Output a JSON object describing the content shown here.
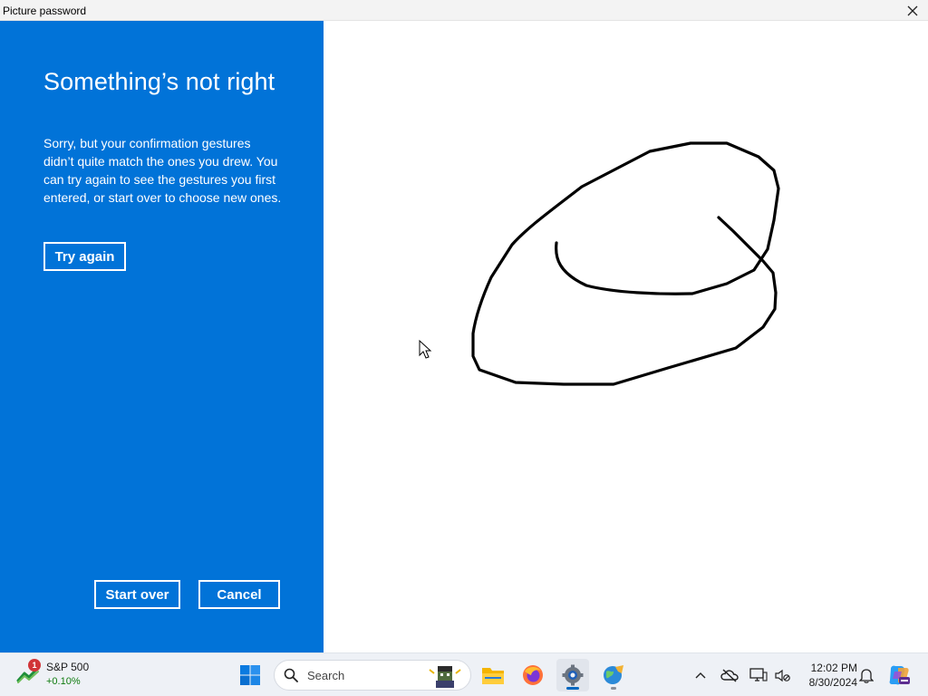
{
  "window": {
    "title": "Picture password"
  },
  "panel": {
    "heading": "Something’s not right",
    "message": "Sorry, but your confirmation gestures didn’t quite match the ones you drew. You can try again to see the gestures you first entered, or start over to choose new ones.",
    "try_again_label": "Try again",
    "start_over_label": "Start over",
    "cancel_label": "Cancel"
  },
  "colors": {
    "panel_bg": "#0173d8",
    "stroke": "#000000",
    "taskbar_bg": "#eef1f6"
  },
  "taskbar": {
    "widget": {
      "name": "S&P 500",
      "change": "+0.10%",
      "badge": "1"
    },
    "search_placeholder": "Search",
    "apps": [
      "start-icon",
      "file-explorer-icon",
      "firefox-icon",
      "settings-icon",
      "globe-app-icon"
    ],
    "tray_icons": [
      "chevron-up-icon",
      "cloud-offline-icon",
      "display-icon",
      "accessibility-icon",
      "bell-icon",
      "copilot-icon"
    ],
    "time": "12:02 PM",
    "date": "8/30/2024"
  }
}
